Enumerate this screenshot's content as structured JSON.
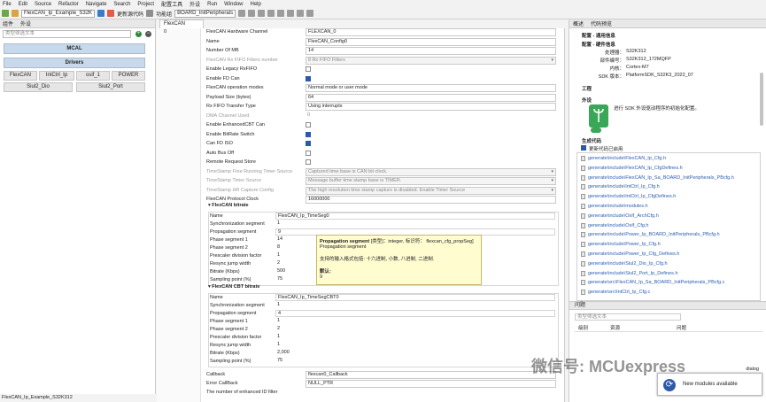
{
  "menu": [
    "File",
    "Edit",
    "Source",
    "Refactor",
    "Navigate",
    "Search",
    "Project",
    "配置工具",
    "外设",
    "Run",
    "Window",
    "Help"
  ],
  "toolbar": {
    "project_combo": "FlexCAN_Ip_Example_S32K",
    "update_code_label": "更新源代码",
    "function_group_label": "功能组",
    "function_group_value": "BOARD_InitPeripherals"
  },
  "left_panel": {
    "tab_label": "组件",
    "tab2_label": "外设",
    "search_placeholder": "类型筛选文本",
    "sections": {
      "mcal": "MCAL",
      "drivers": "Drivers"
    },
    "drivers": [
      "FlexCAN",
      "IntCtrl_Ip",
      "osif_1",
      "POWER",
      "Siul2_Dio",
      "Siul2_Port"
    ],
    "status_text": "FlexCAN_Ip_Example_S32K312"
  },
  "editor": {
    "tab_label": "FlexCAN",
    "gutter_value": "0",
    "fields": [
      {
        "label": "FlexCAN Hardware Channel",
        "value": "FLEXCAN_0",
        "type": "text"
      },
      {
        "label": "Name",
        "value": "FlexCAN_Config0",
        "type": "text"
      },
      {
        "label": "Number Of MB",
        "value": "14",
        "type": "text"
      },
      {
        "label": "FlexCAN Rx FIFO Filters number",
        "value": "8 Rx FIFO Filters",
        "type": "disabled"
      },
      {
        "label": "Enable Legacy RxFIFO",
        "value": "",
        "type": "cb_off"
      },
      {
        "label": "Enable FD Can",
        "value": "",
        "type": "cb_on"
      },
      {
        "label": "FlexCAN operation modes",
        "value": "Normal mode or user mode",
        "type": "text"
      },
      {
        "label": "Payload Size (bytes)",
        "value": "64",
        "type": "text"
      },
      {
        "label": "Rx FIFO Transfer Type",
        "value": "Using interrupts",
        "type": "text"
      },
      {
        "label": "DMA Channel Used",
        "value": "0",
        "type": "plain_dis"
      },
      {
        "label": "Enable EnhancedCBT Can",
        "value": "",
        "type": "cb_off"
      },
      {
        "label": "Enable BitRate Switch",
        "value": "",
        "type": "cb_on"
      },
      {
        "label": "Can FD ISO",
        "value": "",
        "type": "cb_on"
      },
      {
        "label": "Auto Bus Off",
        "value": "",
        "type": "cb_off"
      },
      {
        "label": "Remote Request Store",
        "value": "",
        "type": "cb_off"
      },
      {
        "label": "TimeStamp Free Running Timer Source",
        "value": "Captured time base is CAN bit clock.",
        "type": "disabled"
      },
      {
        "label": "TimeStamp Timer Source",
        "value": "Message buffer time stamp base is TIMER.",
        "type": "disabled"
      },
      {
        "label": "TimeStamp HR Capture Config",
        "value": "The high resolution time stamp capture is disabled. Enable Timer Source",
        "type": "disabled"
      },
      {
        "label": "FlexCAN Protocol Clock",
        "value": "16000000",
        "type": "text"
      }
    ],
    "bitrate": {
      "header": "FlexCAN bitrate",
      "rows": [
        {
          "label": "Name",
          "value": "FlexCAN_Ip_TimeSeg0"
        },
        {
          "label": "Synchronization segment",
          "value": "1"
        },
        {
          "label": "Propagation segment",
          "value": "9"
        },
        {
          "label": "Phase segment 1",
          "value": "14"
        },
        {
          "label": "Phase segment 2",
          "value": "8"
        },
        {
          "label": "Prescaler division factor",
          "value": "1"
        },
        {
          "label": "Resync jump width",
          "value": "2"
        },
        {
          "label": "Bitrate (Kbps)",
          "value": "500"
        },
        {
          "label": "Sampling point (%)",
          "value": "75"
        }
      ]
    },
    "cbt": {
      "header": "FlexCAN CBT bitrate",
      "rows": [
        {
          "label": "Name",
          "value": "FlexCAN_Ip_TimeSegCBT0"
        },
        {
          "label": "Synchronization segment",
          "value": "1"
        },
        {
          "label": "Propagation segment",
          "value": "4"
        },
        {
          "label": "Phase segment 1",
          "value": "1"
        },
        {
          "label": "Phase segment 2",
          "value": "2"
        },
        {
          "label": "Prescaler division factor",
          "value": "1"
        },
        {
          "label": "Resync jump width",
          "value": "1"
        },
        {
          "label": "Bitrate (Kbps)",
          "value": "2,000"
        },
        {
          "label": "Sampling point (%)",
          "value": "75"
        }
      ]
    },
    "tail": [
      {
        "label": "Callback",
        "value": "flexcan0_Callback"
      },
      {
        "label": "Error CallBack",
        "value": "NULL_PTR"
      },
      {
        "label": "The number of enhanced ID filter",
        "value": ""
      }
    ]
  },
  "tooltip": {
    "title": "Propagation segment",
    "meta": "[类型]：integer, 标识符：  flexcan_cfg_propSeg]",
    "line2": "Propagation segment",
    "desc": "支持的输入格式包括: 十六进制, 小数, 八进制, 二进制.",
    "default_label": "默认:",
    "default_value": "9"
  },
  "right_panel": {
    "tab1": "概述",
    "tab2": "代码预览",
    "cfg_general": "配置 - 通用信息",
    "cfg_hw": "配置 - 硬件信息",
    "hw_lines": [
      {
        "k": "处理器：",
        "v": "S32K312"
      },
      {
        "k": "部件编号：",
        "v": "S32K312_172MQFP"
      },
      {
        "k": "内核：",
        "v": "Cortex-M7"
      },
      {
        "k": "SDK 版本：",
        "v": "PlatformSDK_S32K3_2022_07"
      }
    ],
    "project_head": "工程",
    "peripheral_head": "外设",
    "peripheral_text": "进行 SDK 外设驱动程序的初始化配置。",
    "gen_head": "生成代码",
    "gen_check_label": "更新代码已启用",
    "files": [
      "generate\\include\\FlexCAN_Ip_Cfg.h",
      "generate\\include\\FlexCAN_Ip_CfgDefines.h",
      "generate\\include\\FlexCAN_Ip_Sa_BOARD_InitPeripherals_PBcfg.h",
      "generate\\include\\IntCtrl_Ip_Cfg.h",
      "generate\\include\\IntCtrl_Ip_CfgDefines.h",
      "generate\\include\\modules.h",
      "generate\\include\\OsIf_ArchCfg.h",
      "generate\\include\\OsIf_Cfg.h",
      "generate\\include\\Power_Ip_BOARD_InitPeripherals_PBcfg.h",
      "generate\\include\\Power_Ip_Cfg.h",
      "generate\\include\\Power_Ip_Cfg_Defines.h",
      "generate\\include\\Siul2_Dio_Ip_Cfg.h",
      "generate\\include\\Siul2_Port_Ip_Defines.h",
      "generate\\src\\FlexCAN_Ip_Sa_BOARD_InitPeripherals_PBcfg.c",
      "generate\\src\\IntCtrl_Ip_Cfg.c"
    ]
  },
  "problems": {
    "tab": "问题",
    "filter_placeholder": "类型筛选文本",
    "col_level": "级别",
    "col_resource": "资源",
    "col_issue": "问题"
  },
  "watermark": "微信号: MCUexpress",
  "notification": {
    "title": "dialog",
    "text": "New modules available"
  },
  "colors": {
    "accent": "#2d5aa8",
    "section_bg": "#c7d9ea",
    "tooltip_bg": "#fffcd0",
    "link": "#2a5db0"
  }
}
